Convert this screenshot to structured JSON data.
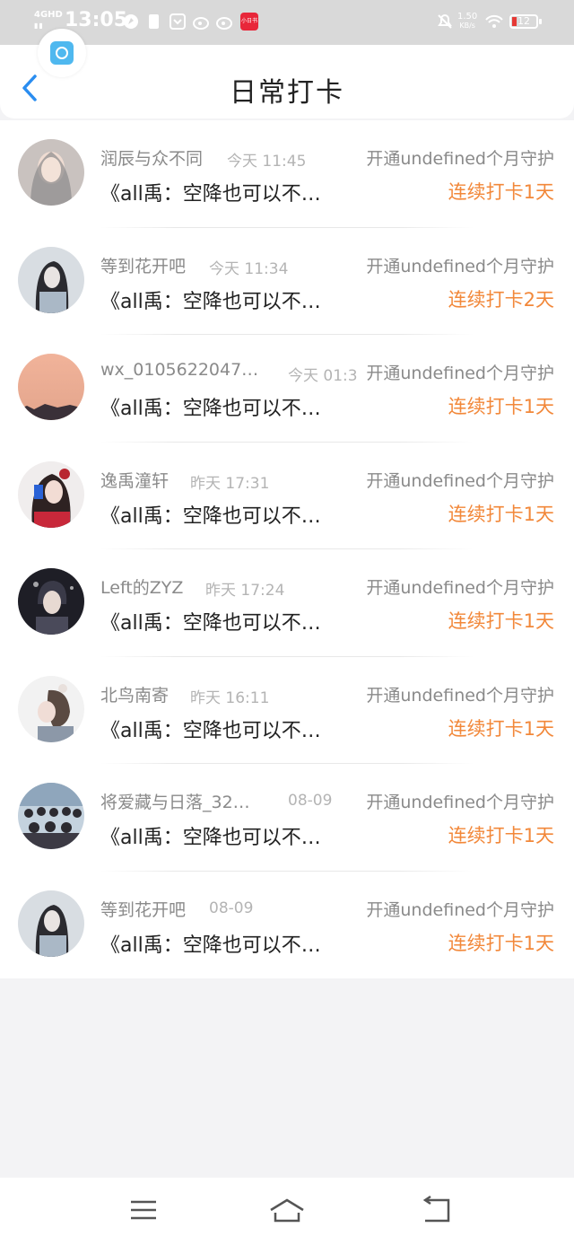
{
  "status_bar": {
    "network": "4GHD",
    "time": "13:05",
    "speed_value": "1.50",
    "speed_unit": "KB/s",
    "battery": "12",
    "app_badge": "小日书"
  },
  "header": {
    "title": "日常打卡"
  },
  "colors": {
    "accent_blue": "#2a8df0",
    "streak_orange": "#f2883a",
    "muted_text": "#8a8a8a"
  },
  "items": [
    {
      "name": "润辰与众不同",
      "time": "今天 11:45",
      "guard": "开通undefined个月守护",
      "message": "《all禹：空降也可以不…",
      "streak": "连续打卡1天"
    },
    {
      "name": "等到花开吧",
      "time": "今天 11:34",
      "guard": "开通undefined个月守护",
      "message": "《all禹：空降也可以不…",
      "streak": "连续打卡2天"
    },
    {
      "name": "wx_0105622047…",
      "time": "今天 01:3",
      "guard": "开通undefined个月守护",
      "message": "《all禹：空降也可以不…",
      "streak": "连续打卡1天"
    },
    {
      "name": "逸禹潼轩",
      "time": "昨天 17:31",
      "guard": "开通undefined个月守护",
      "message": "《all禹：空降也可以不…",
      "streak": "连续打卡1天"
    },
    {
      "name": "Left的ZYZ",
      "time": "昨天 17:24",
      "guard": "开通undefined个月守护",
      "message": "《all禹：空降也可以不…",
      "streak": "连续打卡1天"
    },
    {
      "name": "北鸟南寄",
      "time": "昨天 16:11",
      "guard": "开通undefined个月守护",
      "message": "《all禹：空降也可以不…",
      "streak": "连续打卡1天"
    },
    {
      "name": "将爱藏与日落_32…",
      "time": "08-09",
      "guard": "开通undefined个月守护",
      "message": "《all禹：空降也可以不…",
      "streak": "连续打卡1天"
    },
    {
      "name": "等到花开吧",
      "time": "08-09",
      "guard": "开通undefined个月守护",
      "message": "《all禹：空降也可以不…",
      "streak": "连续打卡1天"
    }
  ]
}
